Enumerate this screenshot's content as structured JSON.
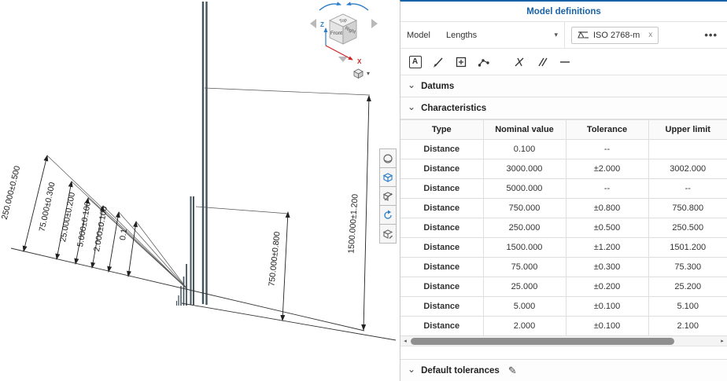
{
  "viewport": {
    "dim_labels": [
      "250.000±0.500",
      "75.000±0.300",
      "25.000±0.200",
      "5.000±0.100",
      "2.000±0.100",
      "0.1",
      "750.000±0.800",
      "1500.000±1.200"
    ],
    "view_cube": {
      "top": "Top",
      "front": "Front",
      "right": "Right",
      "z_axis": "Z",
      "x_axis": "X"
    }
  },
  "panel": {
    "title": "Model definitions",
    "model_row": {
      "label": "Model",
      "selected": "Lengths",
      "standard": {
        "label": "ISO 2768-m",
        "close": "x"
      },
      "overflow": "•••"
    },
    "sections": {
      "datums": "Datums",
      "characteristics": "Characteristics",
      "default_tolerances": "Default tolerances"
    },
    "table": {
      "headers": [
        "Type",
        "Nominal value",
        "Tolerance",
        "Upper limit"
      ],
      "rows": [
        [
          "Distance",
          "0.100",
          "--",
          ""
        ],
        [
          "Distance",
          "3000.000",
          "±2.000",
          "3002.000"
        ],
        [
          "Distance",
          "5000.000",
          "--",
          "--"
        ],
        [
          "Distance",
          "750.000",
          "±0.800",
          "750.800"
        ],
        [
          "Distance",
          "250.000",
          "±0.500",
          "250.500"
        ],
        [
          "Distance",
          "1500.000",
          "±1.200",
          "1501.200"
        ],
        [
          "Distance",
          "75.000",
          "±0.300",
          "75.300"
        ],
        [
          "Distance",
          "25.000",
          "±0.200",
          "25.200"
        ],
        [
          "Distance",
          "5.000",
          "±0.100",
          "5.100"
        ],
        [
          "Distance",
          "2.000",
          "±0.100",
          "2.100"
        ]
      ]
    }
  },
  "glyphs": {
    "chevron": "⌄",
    "dropdown": "▾",
    "edit": "✎",
    "scroll_left": "◂",
    "scroll_right": "▸",
    "label_tool": "A"
  }
}
